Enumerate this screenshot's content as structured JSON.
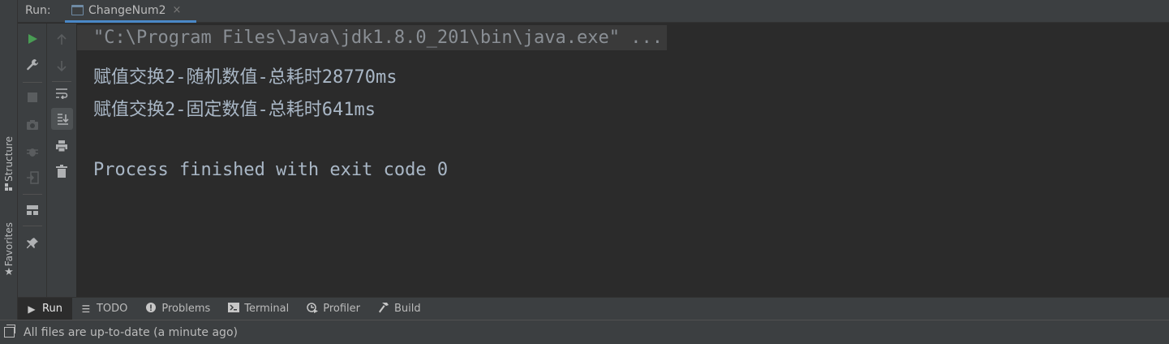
{
  "run_panel": {
    "header_label": "Run:",
    "tab_label": "ChangeNum2",
    "tab_close": "×"
  },
  "side_tabs": {
    "structure": "Structure",
    "favorites": "Favorites"
  },
  "console": {
    "command_line": "\"C:\\Program Files\\Java\\jdk1.8.0_201\\bin\\java.exe\" ...",
    "output_lines": [
      "赋值交换2-随机数值-总耗时28770ms",
      "赋值交换2-固定数值-总耗时641ms",
      "",
      "Process finished with exit code 0"
    ]
  },
  "toolbar_icons": {
    "rerun": "play-icon",
    "settings": "wrench-icon",
    "stop": "stop-icon",
    "dump": "camera-icon",
    "debug": "bug-icon",
    "exit": "exit-icon",
    "layout": "layout-icon",
    "pin": "pin-icon",
    "up": "arrow-up-icon",
    "down": "arrow-down-icon",
    "wrap": "soft-wrap-icon",
    "scroll_end": "scroll-to-end-icon",
    "print": "print-icon",
    "trash": "trash-icon"
  },
  "bottom_tabs": [
    {
      "label": "Run",
      "icon": "run-icon",
      "active": true
    },
    {
      "label": "TODO",
      "icon": "list-icon",
      "active": false
    },
    {
      "label": "Problems",
      "icon": "info-icon",
      "active": false
    },
    {
      "label": "Terminal",
      "icon": "terminal-icon",
      "active": false
    },
    {
      "label": "Profiler",
      "icon": "profiler-icon",
      "active": false
    },
    {
      "label": "Build",
      "icon": "hammer-icon",
      "active": false
    }
  ],
  "status_bar": {
    "message": "All files are up-to-date (a minute ago)"
  },
  "colors": {
    "background": "#2b2b2b",
    "panel": "#3c3f41",
    "console_text": "#a9b7c6",
    "run_green": "#499c54",
    "accent_blue": "#4a88c7"
  }
}
